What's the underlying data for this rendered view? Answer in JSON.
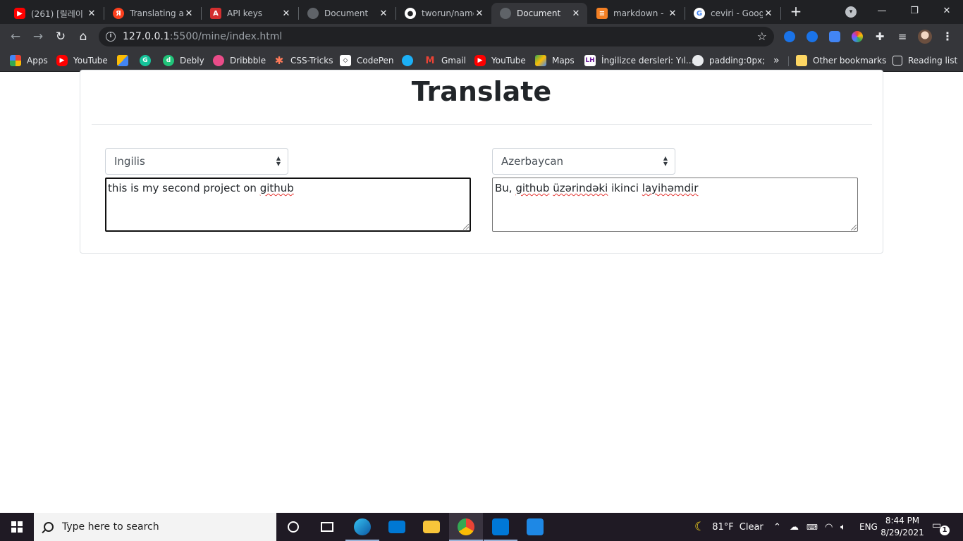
{
  "browser": {
    "tabs": [
      {
        "title": "(261) [릴레이",
        "icon": "youtube-icon",
        "color": "#ff0000"
      },
      {
        "title": "Translating a t",
        "icon": "yandex-icon",
        "color": "#fc3f1d"
      },
      {
        "title": "API keys",
        "icon": "api-icon",
        "color": "#d32f2f"
      },
      {
        "title": "Document",
        "icon": "globe-icon",
        "color": "#5f6368"
      },
      {
        "title": "tworun/name",
        "icon": "github-icon",
        "color": "#ffffff"
      },
      {
        "title": "Document",
        "icon": "globe-icon",
        "color": "#5f6368"
      },
      {
        "title": "markdown - H",
        "icon": "stackoverflow-icon",
        "color": "#f48024"
      },
      {
        "title": "ceviri - Googl",
        "icon": "google-icon",
        "color": "#4285f4"
      }
    ],
    "active_tab_index": 5,
    "address": {
      "host": "127.0.0.1",
      "path": ":5500/mine/index.html"
    },
    "bookmarks": [
      {
        "label": "Apps",
        "icon": "apps-grid-icon"
      },
      {
        "label": "YouTube",
        "icon": "youtube-icon"
      },
      {
        "label": "",
        "icon": "google-ads-icon"
      },
      {
        "label": "",
        "icon": "grammarly-icon"
      },
      {
        "label": "Debly",
        "icon": "debly-icon"
      },
      {
        "label": "Dribbble",
        "icon": "dribbble-icon"
      },
      {
        "label": "CSS-Tricks",
        "icon": "css-tricks-icon"
      },
      {
        "label": "CodePen",
        "icon": "codepen-icon"
      },
      {
        "label": "",
        "icon": "duolingo-icon"
      },
      {
        "label": "Gmail",
        "icon": "gmail-icon"
      },
      {
        "label": "YouTube",
        "icon": "youtube-icon"
      },
      {
        "label": "Maps",
        "icon": "maps-icon"
      },
      {
        "label": "İngilizce dersleri: Yıl...",
        "icon": "lh-icon"
      },
      {
        "label": "padding:0px;",
        "icon": "globe-icon"
      }
    ],
    "bookmarks_overflow": "»",
    "other_bookmarks": "Other bookmarks",
    "reading_list": "Reading list"
  },
  "page": {
    "title": "Translate",
    "source_lang": "Ingilis",
    "target_lang": "Azerbaycan",
    "source_text": [
      "this is my second project on ",
      "github"
    ],
    "target_text": [
      "Bu, ",
      "github",
      " ",
      "üzərindəki",
      " ikinci ",
      "layihəmdir"
    ]
  },
  "taskbar": {
    "search_placeholder": "Type here to search",
    "weather": {
      "temp": "81°F",
      "condition": "Clear"
    },
    "language": "ENG",
    "time": "8:44 PM",
    "date": "8/29/2021",
    "notifications": "1"
  }
}
